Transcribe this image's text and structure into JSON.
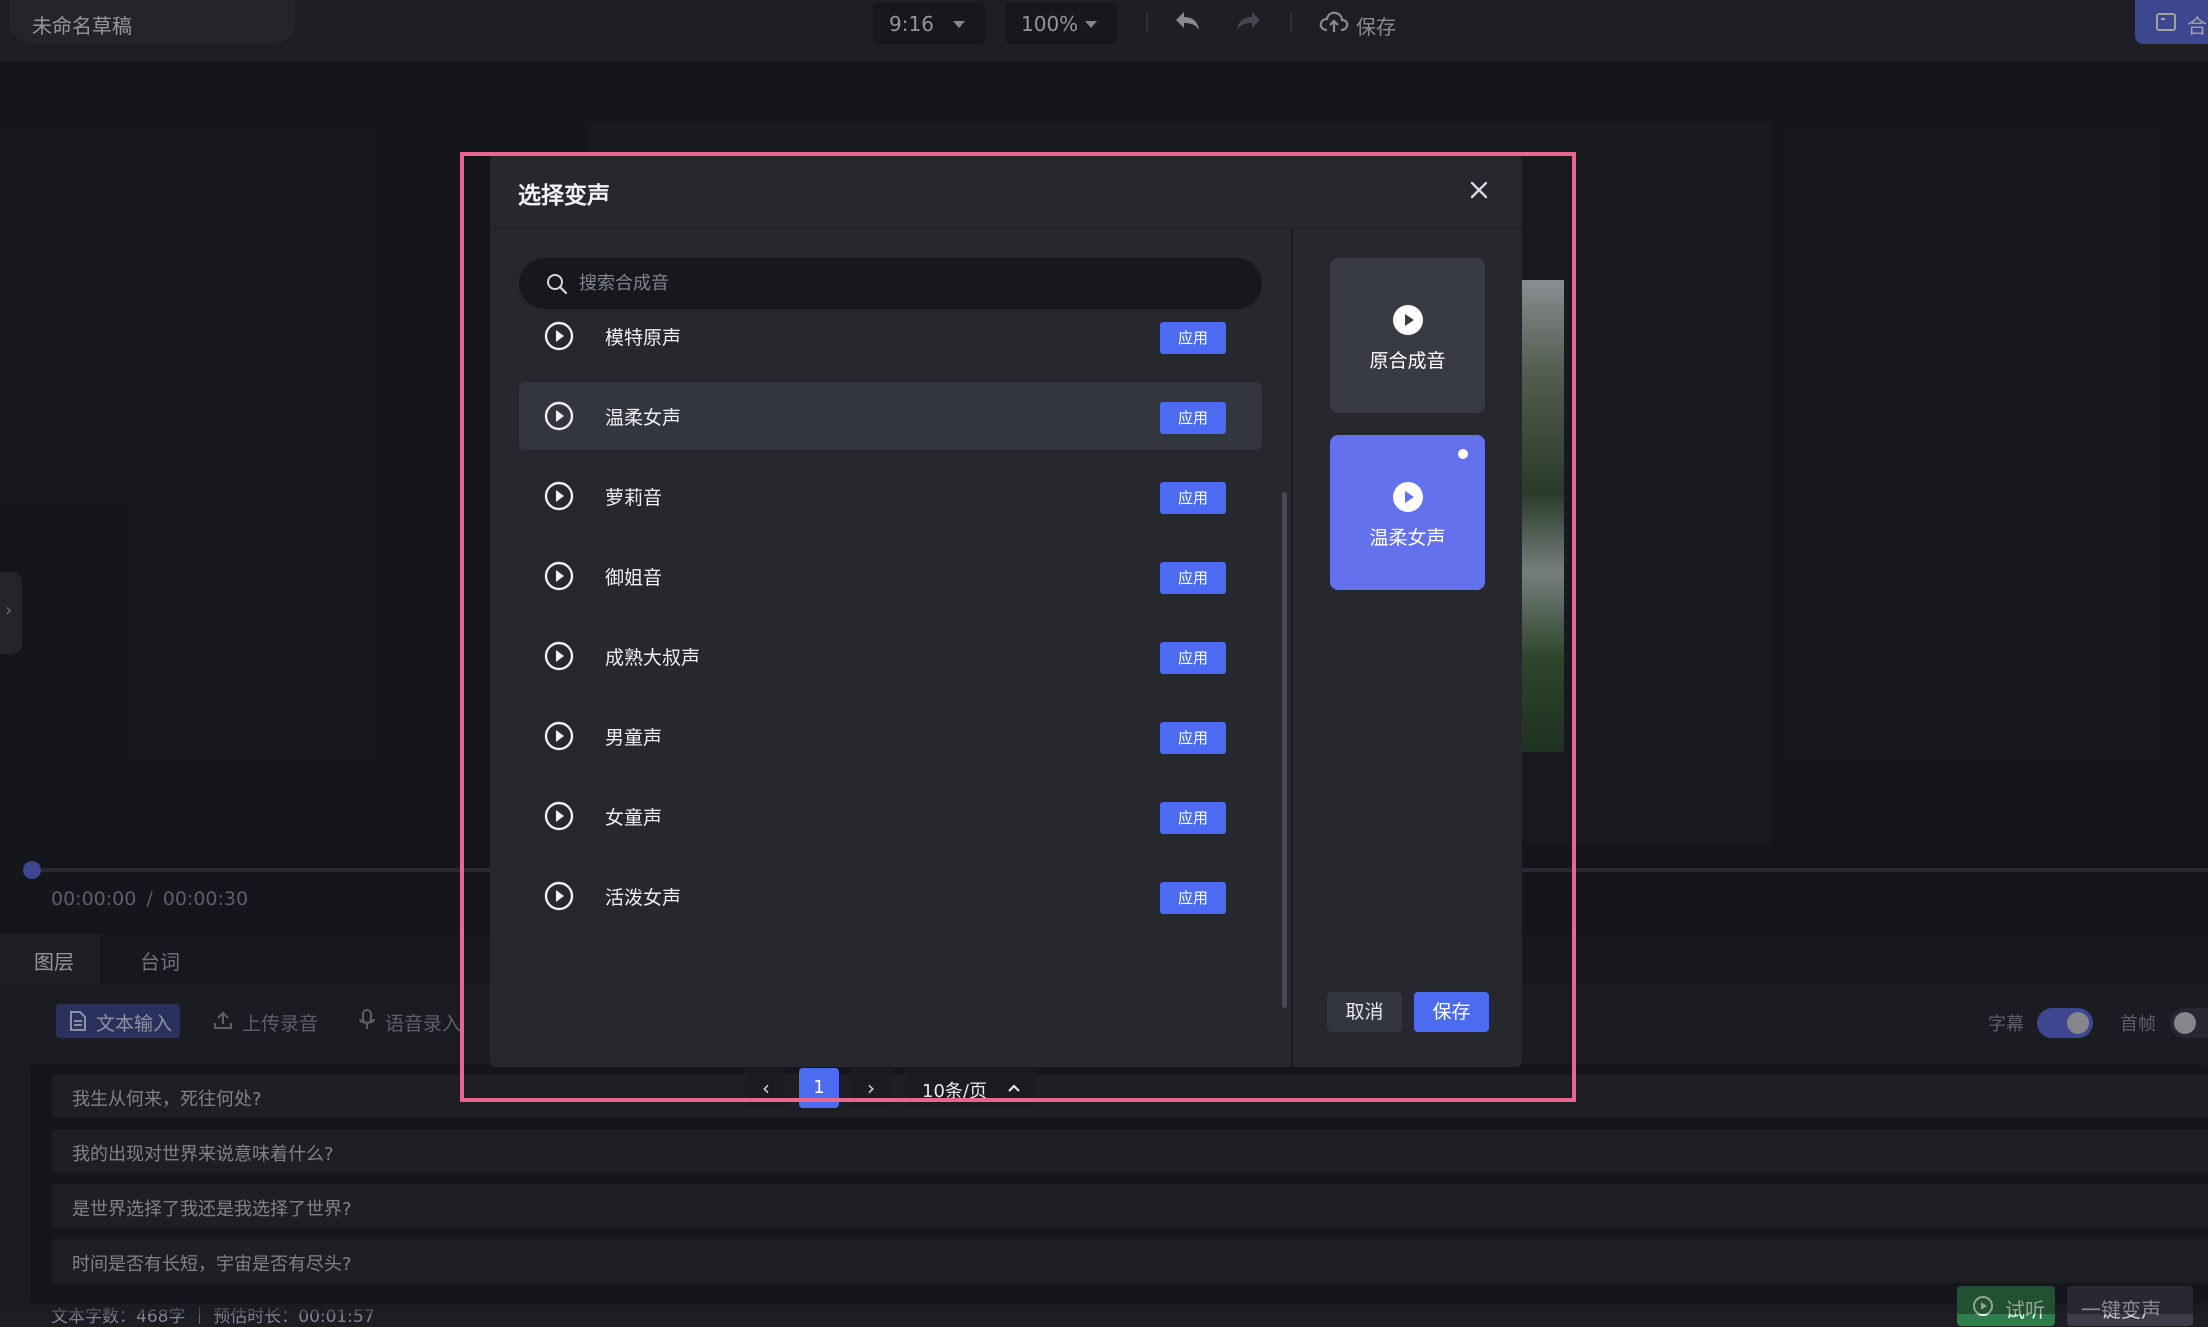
{
  "app": {
    "draft_title": "未命名草稿",
    "aspect_ratio": "9:16",
    "zoom": "100%",
    "save_label": "保存",
    "compose_label": "合"
  },
  "player": {
    "current_time": "00:00:00",
    "separator": "/",
    "total_time": "00:00:30",
    "progress": 0
  },
  "panel": {
    "tabs": [
      "图层",
      "台词"
    ],
    "active_tab": "图层",
    "modes": [
      "文本输入",
      "上传录音",
      "语音录入"
    ],
    "active_mode": "文本输入",
    "toggles": [
      {
        "label": "字幕",
        "on": true
      },
      {
        "label": "首帧",
        "on": false
      }
    ],
    "script_lines": [
      "我生从何来，死往何处?",
      "我的出现对世界来说意味着什么?",
      "是世界选择了我还是我选择了世界?",
      "时间是否有长短，宇宙是否有尽头?"
    ],
    "stats": "文本字数：468字 ｜ 预估时长：00:01:57",
    "listen_label": "试听",
    "onekey_label": "一键变声"
  },
  "modal": {
    "title": "选择变声",
    "search_placeholder": "搜索合成音",
    "apply_label": "应用",
    "voices": [
      {
        "name": "模特原声",
        "selected": false
      },
      {
        "name": "温柔女声",
        "selected": true
      },
      {
        "name": "萝莉音",
        "selected": false
      },
      {
        "name": "御姐音",
        "selected": false
      },
      {
        "name": "成熟大叔声",
        "selected": false
      },
      {
        "name": "男童声",
        "selected": false
      },
      {
        "name": "女童声",
        "selected": false
      },
      {
        "name": "活泼女声",
        "selected": false
      }
    ],
    "pagination": {
      "prev": "‹",
      "current_page": "1",
      "next": "›",
      "page_size": "10条/页"
    },
    "cards": {
      "original_label": "原合成音",
      "selected_label": "温柔女声"
    },
    "cancel_label": "取消",
    "save_label": "保存"
  },
  "colors": {
    "accent": "#4b6cf0",
    "selected_card": "#6471ec",
    "highlight_border": "#e9668f",
    "listen_green": "#2f7d4a"
  },
  "icons": [
    "play-icon",
    "search-icon",
    "close-icon",
    "undo-icon",
    "redo-icon",
    "cloud-upload-icon",
    "upload-icon",
    "mic-icon",
    "document-icon",
    "chevron-up-icon",
    "chevron-down-icon"
  ]
}
